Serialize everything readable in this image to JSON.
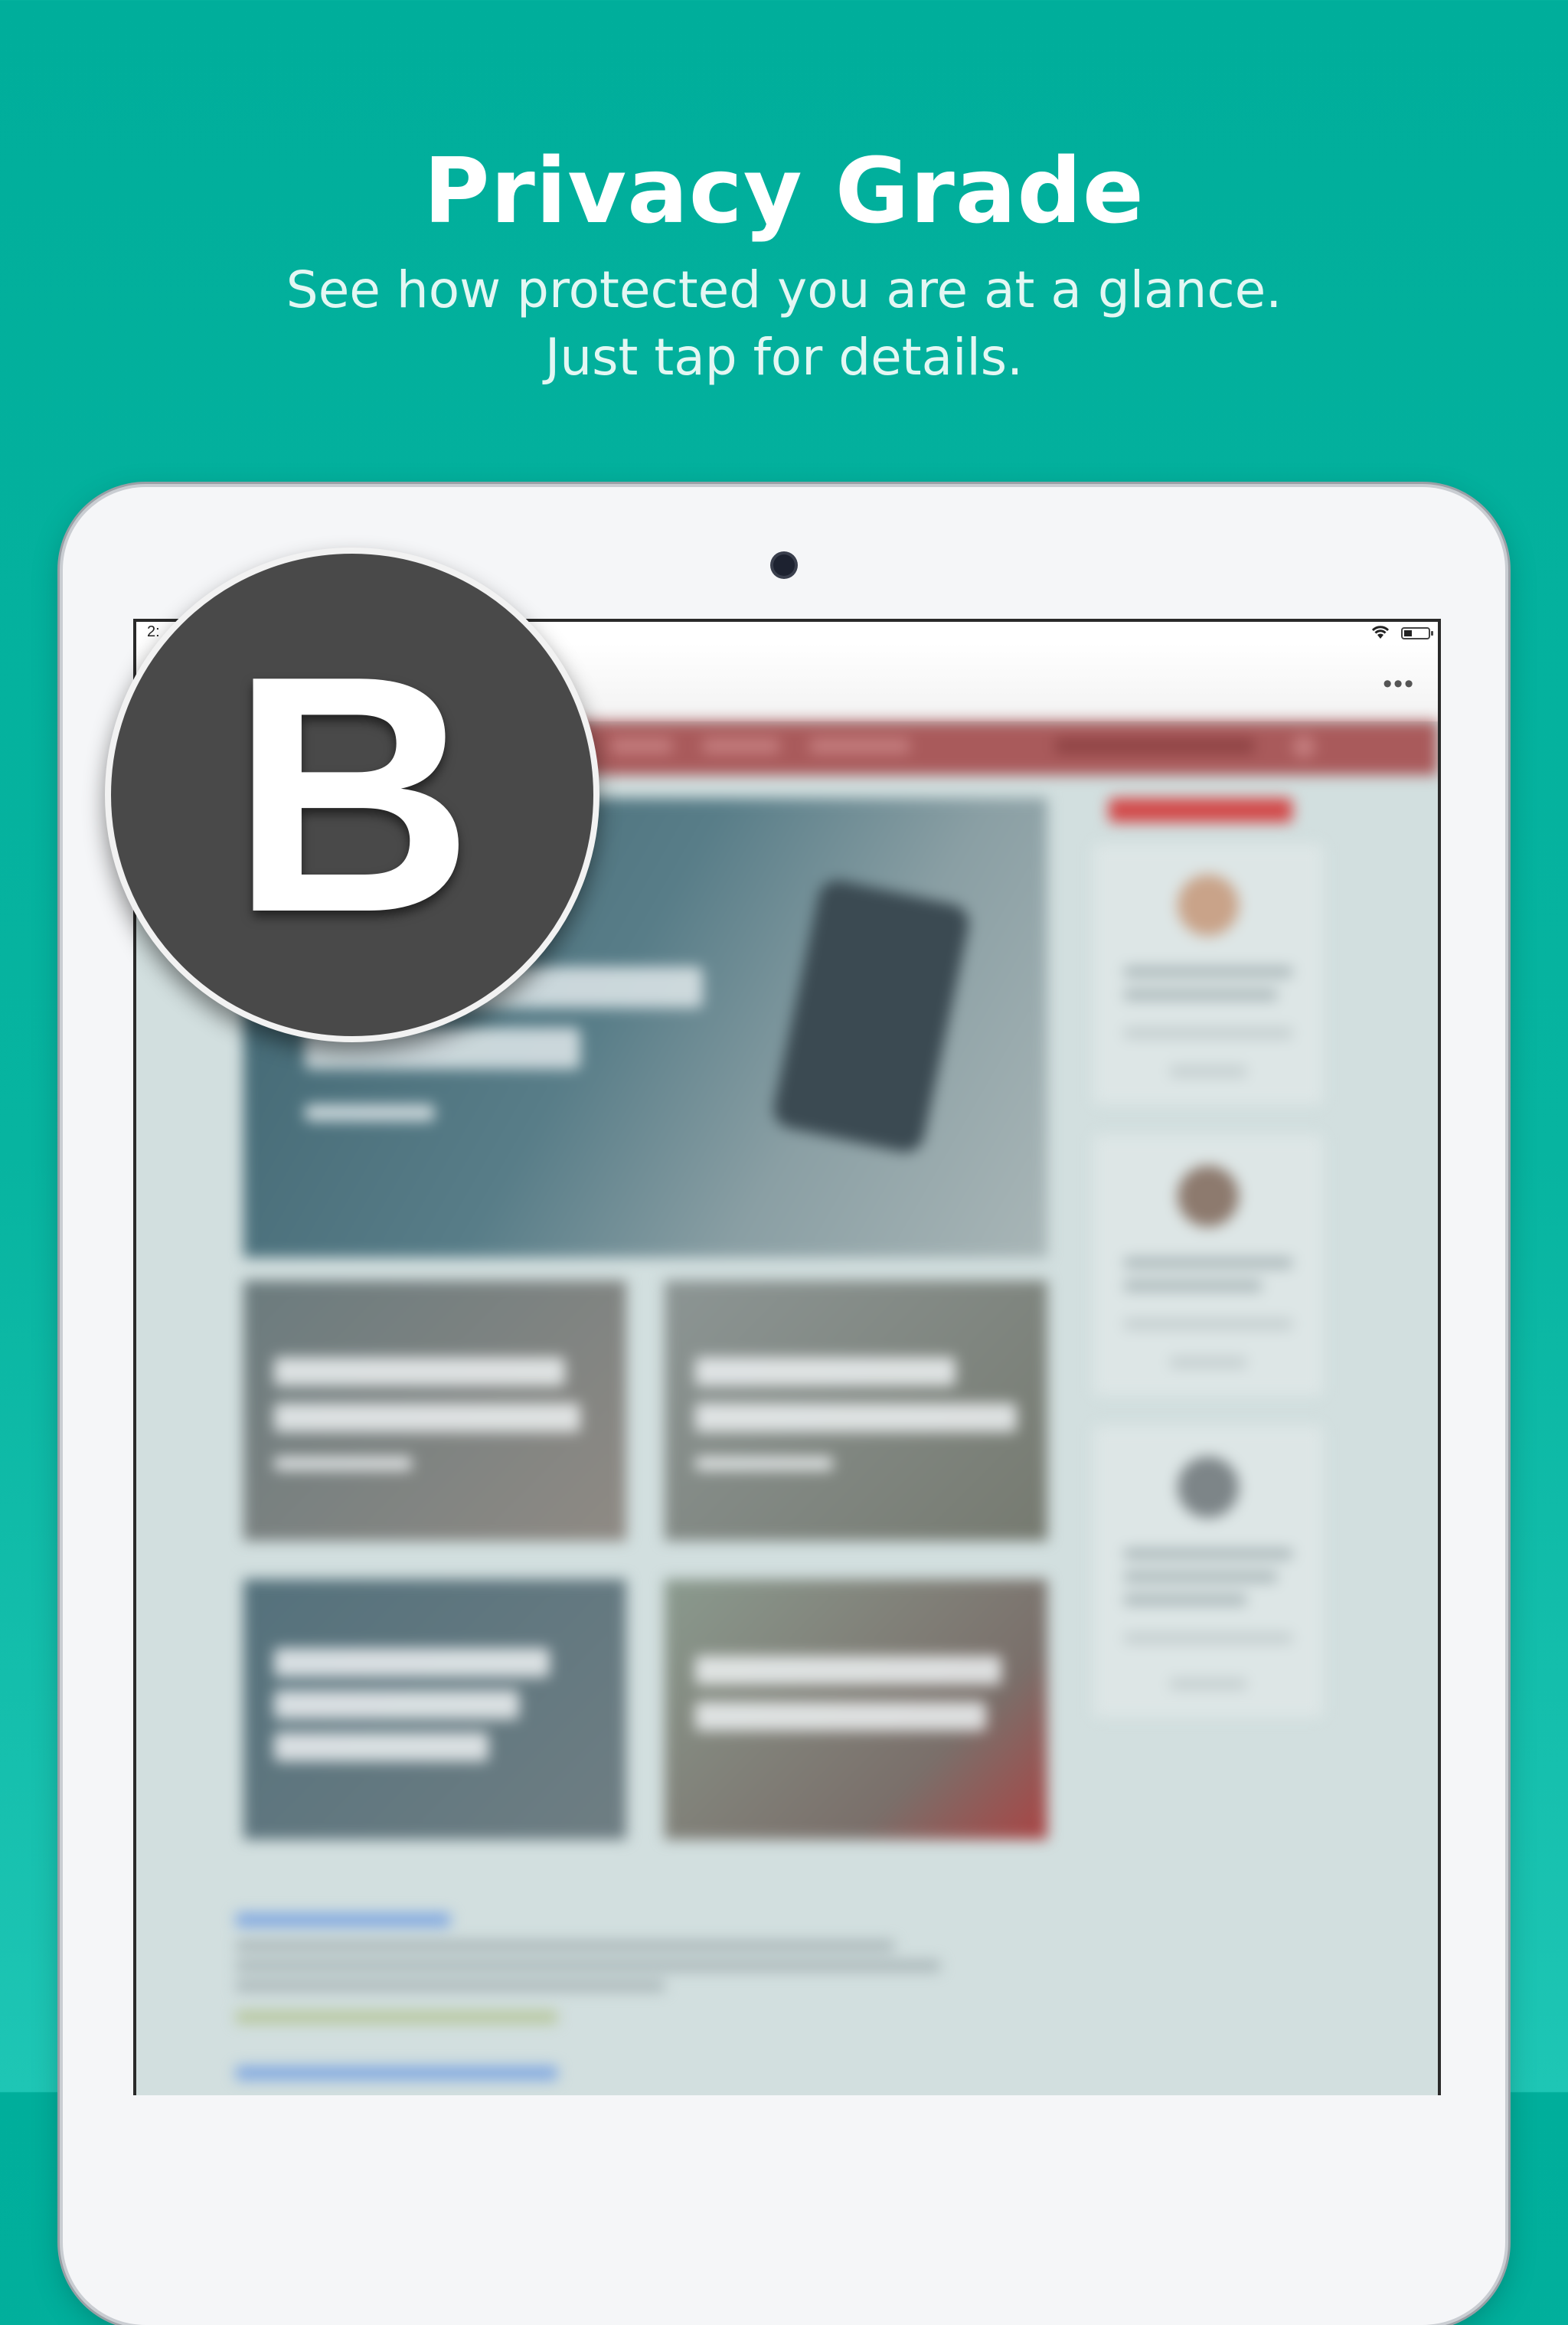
{
  "header": {
    "title": "Privacy Grade",
    "subtitle_line1": "See how protected you are at a glance.",
    "subtitle_line2": "Just tap for details."
  },
  "status_bar": {
    "time": "2:"
  },
  "browser": {
    "more_label": "•••"
  },
  "grade": {
    "letter": "B"
  },
  "colors": {
    "background": "#00ae9b",
    "badge": "#494949",
    "site_nav": "#a95a5b"
  }
}
